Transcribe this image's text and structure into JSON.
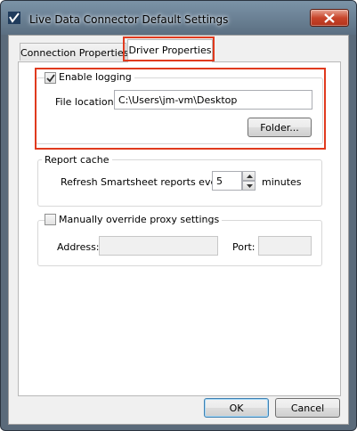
{
  "window": {
    "title": "Live Data Connector Default Settings"
  },
  "tabs": [
    {
      "label": "Connection Properties",
      "selected": false
    },
    {
      "label": "Driver Properties",
      "selected": true
    }
  ],
  "logging": {
    "enable_label": "Enable logging",
    "enabled": true,
    "file_location_label": "File location:",
    "file_location_value": "C:\\Users\\jm-vm\\Desktop",
    "folder_button": "Folder..."
  },
  "report_cache": {
    "group_label": "Report cache",
    "refresh_label": "Refresh Smartsheet reports every",
    "refresh_value": "5",
    "unit_label": "minutes"
  },
  "proxy": {
    "override_label": "Manually override proxy settings",
    "enabled": false,
    "address_label": "Address:",
    "address_value": "",
    "port_label": "Port:",
    "port_value": ""
  },
  "buttons": {
    "ok": "OK",
    "cancel": "Cancel"
  },
  "colors": {
    "highlight": "#e03a1e",
    "titlebar": "#6b8194",
    "close_button": "#c8452b"
  },
  "icons": {
    "app": "smartsheet-logo-icon",
    "close": "close-icon",
    "check": "checkmark-icon",
    "spin_up": "chevron-up-icon",
    "spin_down": "chevron-down-icon"
  }
}
